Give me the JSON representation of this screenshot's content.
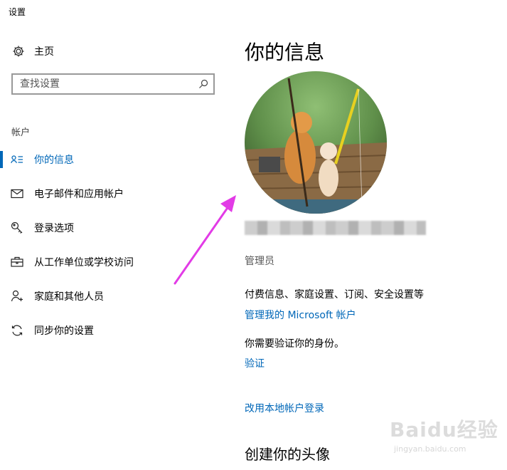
{
  "window": {
    "title": "设置"
  },
  "sidebar": {
    "home_label": "主页",
    "search_placeholder": "查找设置",
    "section_label": "帐户",
    "items": [
      {
        "label": "你的信息",
        "icon": "person-card-icon",
        "active": true
      },
      {
        "label": "电子邮件和应用帐户",
        "icon": "mail-icon",
        "active": false
      },
      {
        "label": "登录选项",
        "icon": "key-icon",
        "active": false
      },
      {
        "label": "从工作单位或学校访问",
        "icon": "briefcase-icon",
        "active": false
      },
      {
        "label": "家庭和其他人员",
        "icon": "add-person-icon",
        "active": false
      },
      {
        "label": "同步你的设置",
        "icon": "sync-icon",
        "active": false
      }
    ]
  },
  "main": {
    "title": "你的信息",
    "role": "管理员",
    "billing_text": "付费信息、家庭设置、订阅、安全设置等",
    "manage_link": "管理我的 Microsoft 帐户",
    "verify_text": "你需要验证你的身份。",
    "verify_link": "验证",
    "local_link": "改用本地帐户登录",
    "create_heading": "创建你的头像"
  },
  "watermark": {
    "brand": "Baidu经验",
    "url": "jingyan.baidu.com"
  },
  "colors": {
    "accent": "#0067b8",
    "arrow": "#e23be6",
    "text": "#000000",
    "muted": "#555555"
  }
}
